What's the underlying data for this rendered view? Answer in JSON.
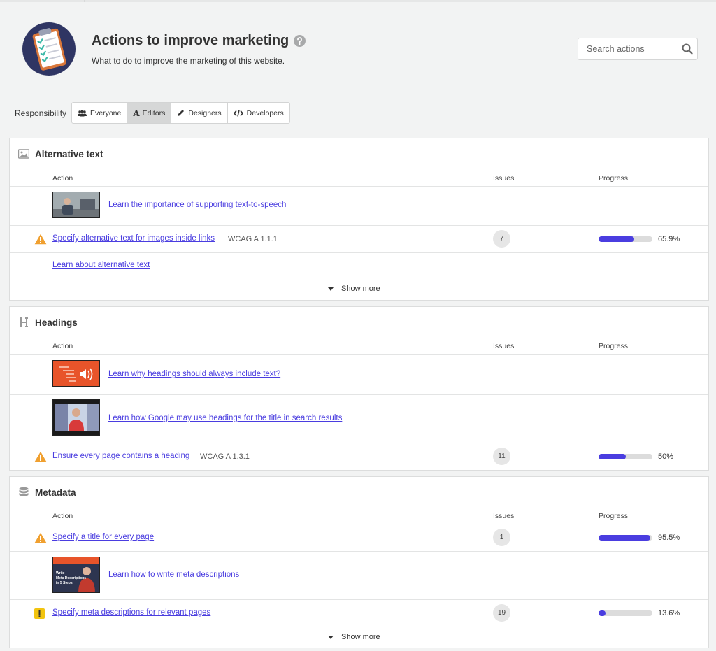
{
  "header": {
    "title": "Actions to improve marketing",
    "subtitle": "What to do to improve the marketing of this website."
  },
  "search": {
    "placeholder": "Search actions"
  },
  "responsibility": {
    "label": "Responsibility",
    "options": [
      {
        "label": "Everyone",
        "icon": "users-icon",
        "active": false
      },
      {
        "label": "Editors",
        "icon": "editor-a-icon",
        "active": true
      },
      {
        "label": "Designers",
        "icon": "pencil-icon",
        "active": false
      },
      {
        "label": "Developers",
        "icon": "code-icon",
        "active": false
      }
    ]
  },
  "columns": {
    "action": "Action",
    "issues": "Issues",
    "progress": "Progress"
  },
  "sections": [
    {
      "title": "Alternative text",
      "icon": "image-icon",
      "rows": [
        {
          "type": "video",
          "link": "Learn the importance of supporting text-to-speech"
        },
        {
          "type": "action",
          "severity": "warning",
          "link": "Specify alternative text for images inside links",
          "wcag": "WCAG A 1.1.1",
          "issues": "7",
          "progress": 0.659,
          "progress_label": "65.9%"
        },
        {
          "type": "link",
          "link": "Learn about alternative text"
        }
      ],
      "show_more": "Show more"
    },
    {
      "title": "Headings",
      "icon": "heading-icon",
      "rows": [
        {
          "type": "video",
          "link": "Learn why headings should always include text?"
        },
        {
          "type": "video",
          "link": "Learn how Google may use headings for the title in search results"
        },
        {
          "type": "action",
          "severity": "warning",
          "link": "Ensure every page contains a heading",
          "wcag": "WCAG A 1.3.1",
          "issues": "11",
          "progress": 0.5,
          "progress_label": "50%"
        }
      ]
    },
    {
      "title": "Metadata",
      "icon": "database-icon",
      "rows": [
        {
          "type": "action",
          "severity": "warning",
          "link": "Specify a title for every page",
          "issues": "1",
          "progress": 0.955,
          "progress_label": "95.5%"
        },
        {
          "type": "video",
          "link": "Learn how to write meta descriptions",
          "thumb_text": "Write Meta Descriptions in 5 Steps"
        },
        {
          "type": "action",
          "severity": "notice",
          "link": "Specify meta descriptions for relevant pages",
          "issues": "19",
          "progress": 0.136,
          "progress_label": "13.6%"
        }
      ],
      "show_more": "Show more"
    }
  ],
  "colors": {
    "accent": "#4a3de0",
    "warning": "#f0a030",
    "notice": "#f2c40f"
  }
}
